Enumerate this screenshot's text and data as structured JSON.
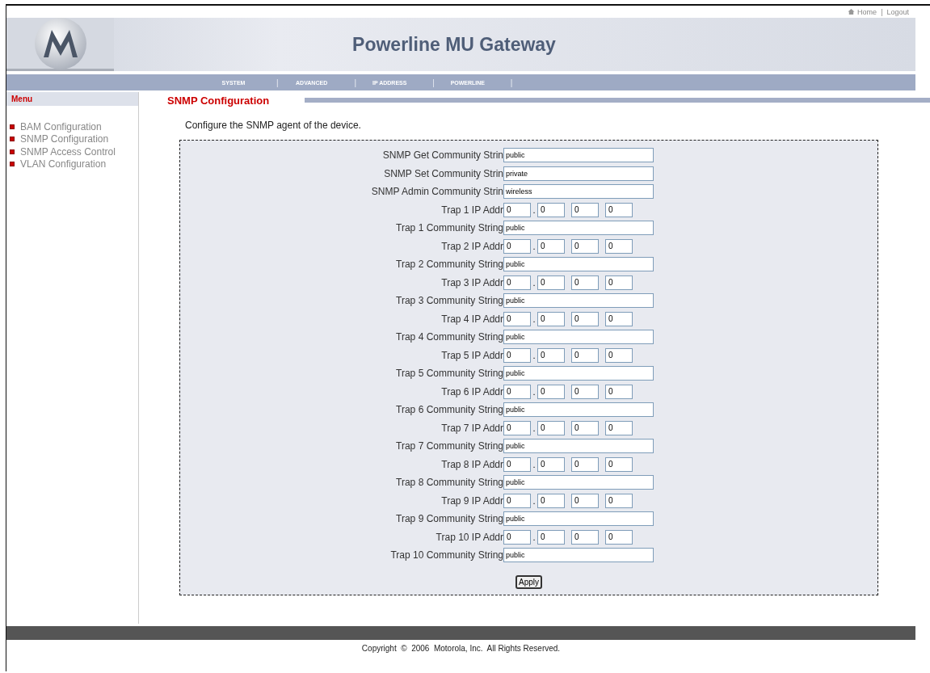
{
  "top_links": [
    {
      "label": "Home",
      "kind": "home"
    },
    {
      "label": "Logout",
      "kind": "plain"
    }
  ],
  "top_separator": "|",
  "banner": {
    "title": "Powerline MU Gateway"
  },
  "nav": [
    "SYSTEM",
    "ADVANCED",
    "IP ADDRESS",
    "POWERLINE"
  ],
  "nav_separator": "|",
  "sidebar": {
    "title": "Menu",
    "items": [
      {
        "label": "BAM Configuration"
      },
      {
        "label": "SNMP Configuration"
      },
      {
        "label": "SNMP Access Control"
      },
      {
        "label": "VLAN Configuration"
      }
    ]
  },
  "page": {
    "title": "SNMP Configuration",
    "description": "Configure the SNMP agent of the device."
  },
  "fields": [
    {
      "kind": "text",
      "label": "SNMP Get Community Strin",
      "value": "public"
    },
    {
      "kind": "text",
      "label": "SNMP Set Community Strin",
      "value": "private"
    },
    {
      "kind": "text",
      "label": "SNMP Admin Community Strin",
      "value": "wireless"
    },
    {
      "kind": "ip",
      "label": "Trap 1 IP Addr",
      "octets": [
        "0",
        "0",
        "0",
        "0"
      ],
      "dot": "."
    },
    {
      "kind": "text",
      "label": "Trap 1 Community String",
      "value": "public"
    },
    {
      "kind": "ip",
      "label": "Trap 2 IP Addr",
      "octets": [
        "0",
        "0",
        "0",
        "0"
      ],
      "dot": "."
    },
    {
      "kind": "text",
      "label": "Trap 2 Community String",
      "value": "public"
    },
    {
      "kind": "ip",
      "label": "Trap 3 IP Addr",
      "octets": [
        "0",
        "0",
        "0",
        "0"
      ],
      "dot": "."
    },
    {
      "kind": "text",
      "label": "Trap 3 Community String",
      "value": "public"
    },
    {
      "kind": "ip",
      "label": "Trap 4 IP Addr",
      "octets": [
        "0",
        "0",
        "0",
        "0"
      ],
      "dot": "."
    },
    {
      "kind": "text",
      "label": "Trap 4 Community String",
      "value": "public"
    },
    {
      "kind": "ip",
      "label": "Trap 5 IP Addr",
      "octets": [
        "0",
        "0",
        "0",
        "0"
      ],
      "dot": "."
    },
    {
      "kind": "text",
      "label": "Trap 5 Community String",
      "value": "public"
    },
    {
      "kind": "ip",
      "label": "Trap 6 IP Addr",
      "octets": [
        "0",
        "0",
        "0",
        "0"
      ],
      "dot": "."
    },
    {
      "kind": "text",
      "label": "Trap 6 Community String",
      "value": "public"
    },
    {
      "kind": "ip",
      "label": "Trap 7 IP Addr",
      "octets": [
        "0",
        "0",
        "0",
        "0"
      ],
      "dot": "."
    },
    {
      "kind": "text",
      "label": "Trap 7 Community String",
      "value": "public"
    },
    {
      "kind": "ip",
      "label": "Trap 8 IP Addr",
      "octets": [
        "0",
        "0",
        "0",
        "0"
      ],
      "dot": "."
    },
    {
      "kind": "text",
      "label": "Trap 8 Community String",
      "value": "public"
    },
    {
      "kind": "ip",
      "label": "Trap 9 IP Addr",
      "octets": [
        "0",
        "0",
        "0",
        "0"
      ],
      "dot": "."
    },
    {
      "kind": "text",
      "label": "Trap 9 Community String",
      "value": "public"
    },
    {
      "kind": "ip",
      "label": "Trap 10 IP Addr",
      "octets": [
        "0",
        "0",
        "0",
        "0"
      ],
      "dot": "."
    },
    {
      "kind": "text",
      "label": "Trap 10 Community String",
      "value": "public"
    }
  ],
  "apply_button": "Apply",
  "footer": "Copyright  ©  2006  Motorola, Inc.  All Rights Reserved."
}
